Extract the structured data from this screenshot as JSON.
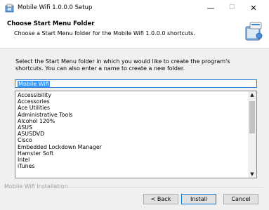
{
  "window": {
    "title": "Mobile Wifi 1.0.0.0 Setup",
    "minimize_glyph": "—",
    "maximize_glyph": "☐",
    "close_glyph": "✕",
    "app_icon": "installer-icon"
  },
  "header": {
    "title": "Choose Start Menu Folder",
    "subtitle": "Choose a Start Menu folder for the Mobile Wifi 1.0.0.0 shortcuts.",
    "icon": "start-menu-folder-icon"
  },
  "body": {
    "description": "Select the Start Menu folder in which you would like to create the program's shortcuts. You can also enter a name to create a new folder.",
    "folder_name": "Mobile Wifi",
    "folders": [
      "Accessibility",
      "Accessories",
      "Ace Utilities",
      "Administrative Tools",
      "Alcohol 120%",
      "ASUS",
      "ASUSDVD",
      "Cisco",
      "Embedded Lockdown Manager",
      "Hamster Soft",
      "Intel",
      "iTunes"
    ]
  },
  "footer": {
    "branding": "Mobile Wifi Installation",
    "back_label": "< Back",
    "install_label": "Install",
    "cancel_label": "Cancel"
  },
  "colors": {
    "selection": "#3399ff",
    "focus_border": "#0078d7"
  }
}
